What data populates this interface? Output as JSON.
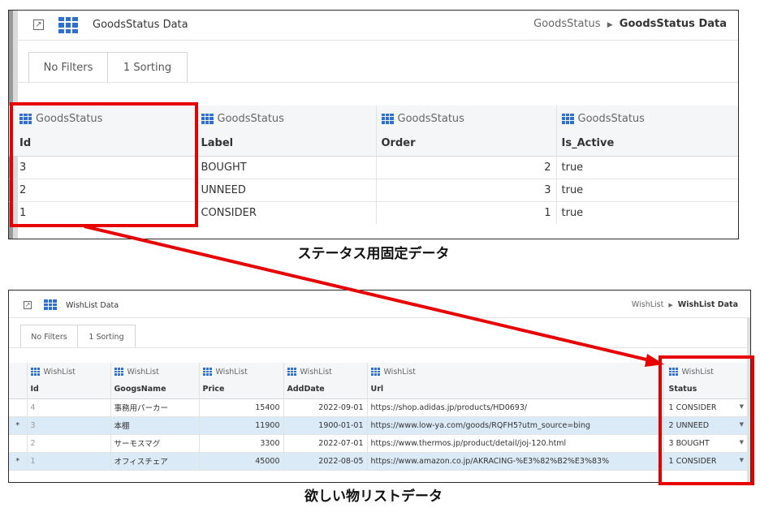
{
  "goods": {
    "title": "GoodsStatus Data",
    "breadcrumb": {
      "parent": "GoodsStatus",
      "current": "GoodsStatus Data"
    },
    "tabs": [
      "No Filters",
      "1 Sorting"
    ],
    "source": "GoodsStatus",
    "columns": [
      "Id",
      "Label",
      "Order",
      "Is_Active"
    ],
    "rows": [
      {
        "id": "3",
        "label": "BOUGHT",
        "order": "2",
        "active": "true"
      },
      {
        "id": "2",
        "label": "UNNEED",
        "order": "3",
        "active": "true"
      },
      {
        "id": "1",
        "label": "CONSIDER",
        "order": "1",
        "active": "true"
      }
    ]
  },
  "caption1": "ステータス用固定データ",
  "wish": {
    "title": "WishList Data",
    "breadcrumb": {
      "parent": "WishList",
      "current": "WishList Data"
    },
    "tabs": [
      "No Filters",
      "1 Sorting"
    ],
    "source": "WishList",
    "columns": [
      "Id",
      "GoogsName",
      "Price",
      "AddDate",
      "Url",
      "Status"
    ],
    "rows": [
      {
        "mark": "",
        "id": "4",
        "name": "事務用パーカー",
        "price": "15400",
        "date": "2022-09-01",
        "url": "https://shop.adidas.jp/products/HD0693/",
        "status": "1 CONSIDER"
      },
      {
        "mark": "*",
        "id": "3",
        "name": "本棚",
        "price": "11900",
        "date": "1900-01-01",
        "url": "https://www.low-ya.com/goods/RQFH5?utm_source=bing",
        "status": "2 UNNEED"
      },
      {
        "mark": "",
        "id": "2",
        "name": "サーモスマグ",
        "price": "3300",
        "date": "2022-07-01",
        "url": "https://www.thermos.jp/product/detail/joj-120.html",
        "status": "3 BOUGHT"
      },
      {
        "mark": "*",
        "id": "1",
        "name": "オフィスチェア",
        "price": "45000",
        "date": "2022-08-05",
        "url": "https://www.amazon.co.jp/AKRACING-%E3%82%B2%E3%83%",
        "status": "1 CONSIDER"
      }
    ]
  },
  "caption2": "欲しい物リストデータ",
  "colors": {
    "highlight": "#e60000",
    "icon": "#2f6fd1",
    "selected_row": "#dbeaf7"
  }
}
